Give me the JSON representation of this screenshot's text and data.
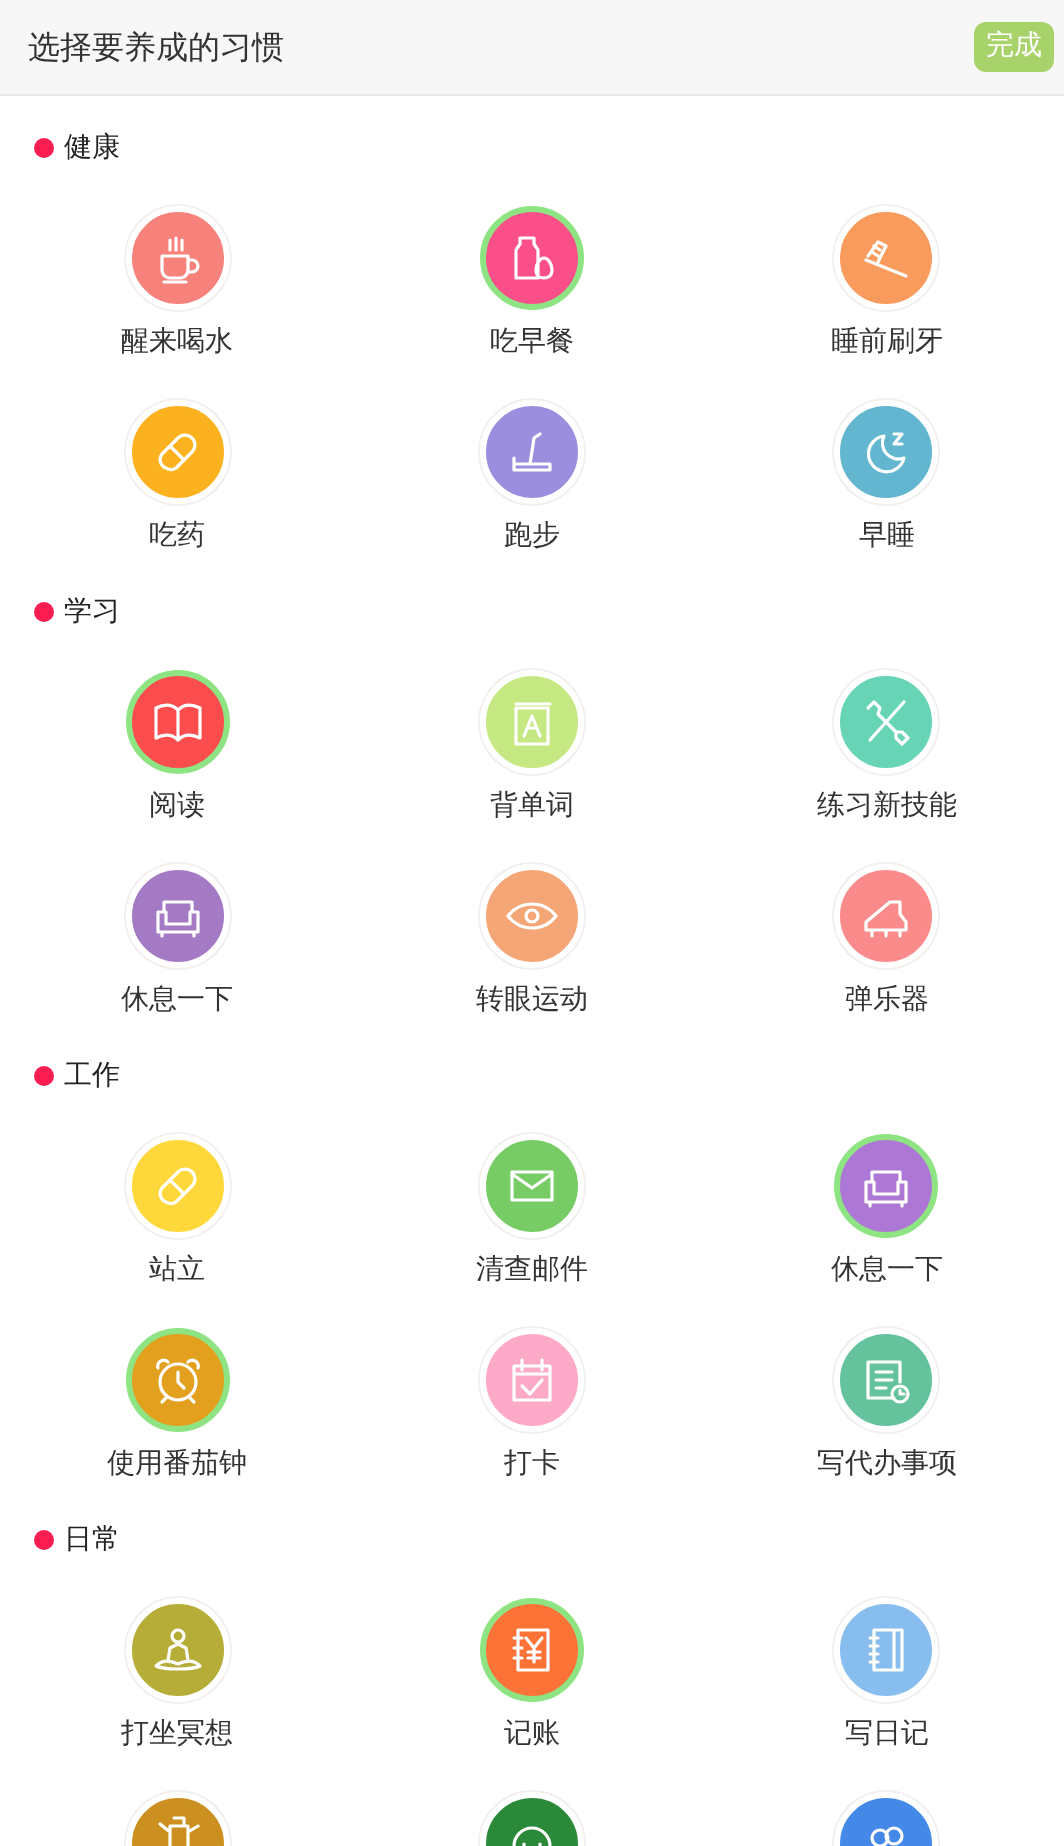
{
  "header": {
    "title": "选择要养成的习惯",
    "done_button": "完成"
  },
  "sections": [
    {
      "title": "健康",
      "items": [
        {
          "label": "醒来喝水",
          "kind": "cup",
          "color": "#f7827c",
          "selected": false
        },
        {
          "label": "吃早餐",
          "kind": "bottle",
          "color": "#fb4f8a",
          "selected": true
        },
        {
          "label": "睡前刷牙",
          "kind": "toothbrush",
          "color": "#f99b5c",
          "selected": false
        },
        {
          "label": "吃药",
          "kind": "pill",
          "color": "#fcb21f",
          "selected": false
        },
        {
          "label": "跑步",
          "kind": "treadmill",
          "color": "#9b8ede",
          "selected": false
        },
        {
          "label": "早睡",
          "kind": "moon",
          "color": "#62b6d0",
          "selected": false
        }
      ]
    },
    {
      "title": "学习",
      "items": [
        {
          "label": "阅读",
          "kind": "book",
          "color": "#fb4d4d",
          "selected": true
        },
        {
          "label": "背单词",
          "kind": "letter",
          "color": "#c6e883",
          "selected": false
        },
        {
          "label": "练习新技能",
          "kind": "tools",
          "color": "#68d4b6",
          "selected": false
        },
        {
          "label": "休息一下",
          "kind": "sofa",
          "color": "#a57ac4",
          "selected": false
        },
        {
          "label": "转眼运动",
          "kind": "eye",
          "color": "#f4a676",
          "selected": false
        },
        {
          "label": "弹乐器",
          "kind": "piano",
          "color": "#fb8b8b",
          "selected": false
        }
      ]
    },
    {
      "title": "工作",
      "items": [
        {
          "label": "站立",
          "kind": "pill",
          "color": "#fed83a",
          "selected": false
        },
        {
          "label": "清查邮件",
          "kind": "mail",
          "color": "#77cc66",
          "selected": false
        },
        {
          "label": "休息一下",
          "kind": "sofa",
          "color": "#ad77d6",
          "selected": true
        },
        {
          "label": "使用番茄钟",
          "kind": "alarm",
          "color": "#e39f1e",
          "selected": true
        },
        {
          "label": "打卡",
          "kind": "calendar",
          "color": "#fdaac8",
          "selected": false
        },
        {
          "label": "写代办事项",
          "kind": "notes",
          "color": "#64c39d",
          "selected": false
        }
      ]
    },
    {
      "title": "日常",
      "items": [
        {
          "label": "打坐冥想",
          "kind": "meditate",
          "color": "#b5ad38",
          "selected": false
        },
        {
          "label": "记账",
          "kind": "ledger",
          "color": "#fd7337",
          "selected": true
        },
        {
          "label": "写日记",
          "kind": "notebook",
          "color": "#88bdf0",
          "selected": false
        },
        {
          "kind": "can",
          "color": "#cc9020",
          "selected": false
        },
        {
          "kind": "face",
          "color": "#2a8a3a",
          "selected": false
        },
        {
          "kind": "people",
          "color": "#4488e8",
          "selected": false
        }
      ]
    }
  ]
}
